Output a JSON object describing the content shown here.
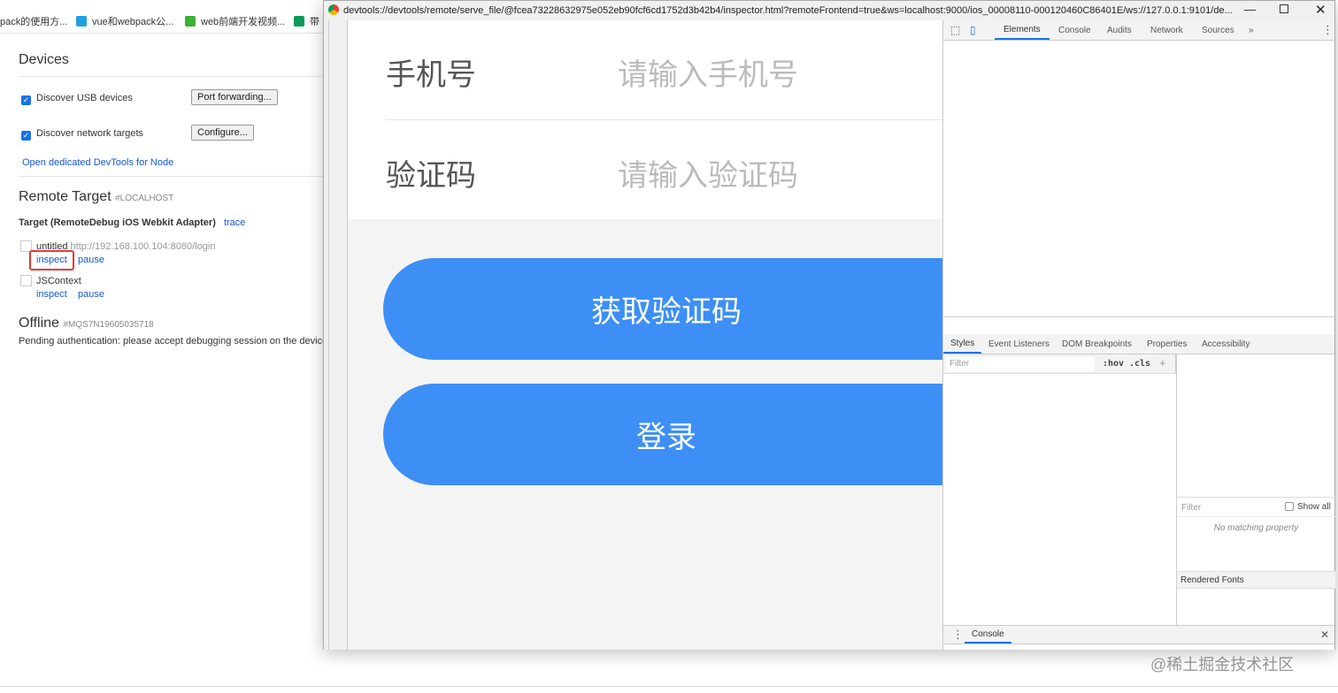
{
  "bookmarks": [
    "pack的使用方...",
    "vue和webpack公...",
    "web前端开发视频...",
    "带"
  ],
  "devices": {
    "title": "Devices",
    "usb_label": "Discover USB devices",
    "usb_checked": true,
    "port_forwarding": "Port forwarding...",
    "network_label": "Discover network targets",
    "network_checked": true,
    "configure": "Configure...",
    "open_node": "Open dedicated DevTools for Node"
  },
  "remote": {
    "title": "Remote Target",
    "host": "#LOCALHOST",
    "target": "Target (RemoteDebug iOS Webkit Adapter)",
    "trace": "trace",
    "items": [
      {
        "name": "untitled",
        "url": "http://192.168.100.104:8080/login",
        "inspect": "inspect",
        "pause": "pause"
      },
      {
        "name": "JSContext",
        "url": "",
        "inspect": "inspect",
        "pause": "pause"
      }
    ]
  },
  "offline": {
    "title": "Offline",
    "serial": "#MQS7N19605035718",
    "message": "Pending authentication: please accept debugging session on the device."
  },
  "window": {
    "url": "devtools://devtools/remote/serve_file/@fcea73228632975e052eb90fcf6cd1752d3b42b4/inspector.html?remoteFrontend=true&ws=localhost:9000/ios_00008110-000120460C86401E/ws://127.0.0.1:9101/de..."
  },
  "page": {
    "phone_label": "手机号",
    "phone_placeholder": "请输入手机号",
    "code_label": "验证码",
    "code_placeholder": "请输入验证码",
    "get_code": "获取验证码",
    "login": "登录"
  },
  "devtools": {
    "tabs": [
      "Elements",
      "Console",
      "Audits",
      "Network",
      "Sources"
    ],
    "more": "»",
    "sub_tabs": [
      "Styles",
      "Event Listeners",
      "DOM Breakpoints",
      "Properties",
      "Accessibility"
    ],
    "filter_placeholder": "Filter",
    "hov": ":hov",
    "cls": ".cls",
    "plus": "+",
    "computed_filter": "Filter",
    "show_all": "Show all",
    "no_match": "No matching property",
    "rendered_fonts": "Rendered Fonts",
    "drawer_tab": "Console"
  },
  "watermark": "@稀土掘金技术社区",
  "colors": {
    "accent": "#3d8ff5",
    "link": "#1558d6"
  }
}
